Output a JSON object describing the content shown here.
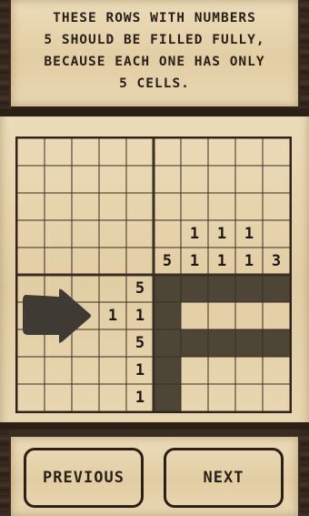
{
  "instruction": {
    "lines": [
      "These rows with numbers",
      "5 should be filled fully,",
      "because each one has only",
      "5 cells."
    ]
  },
  "puzzle": {
    "size": 10,
    "column_clues": [
      [],
      [],
      [],
      [],
      [],
      [
        "5"
      ],
      [
        "1",
        "1"
      ],
      [
        "1",
        "1"
      ],
      [
        "1",
        "1"
      ],
      [
        "3"
      ]
    ],
    "row_clues": [
      [],
      [],
      [],
      [],
      [],
      [
        "5"
      ],
      [
        "1",
        "1"
      ],
      [
        "5"
      ],
      [
        "1"
      ],
      [
        "1"
      ]
    ],
    "filled_rows": [
      [
        1,
        1,
        1,
        1,
        1
      ],
      [
        1,
        0,
        0,
        0,
        0
      ],
      [
        1,
        1,
        1,
        1,
        1
      ],
      [
        1,
        0,
        0,
        0,
        0
      ],
      [
        1,
        0,
        0,
        0,
        0
      ]
    ]
  },
  "arrow": {
    "icon": "arrow-right-icon",
    "points_to_row": 6
  },
  "nav": {
    "previous_label": "Previous",
    "next_label": "Next"
  }
}
